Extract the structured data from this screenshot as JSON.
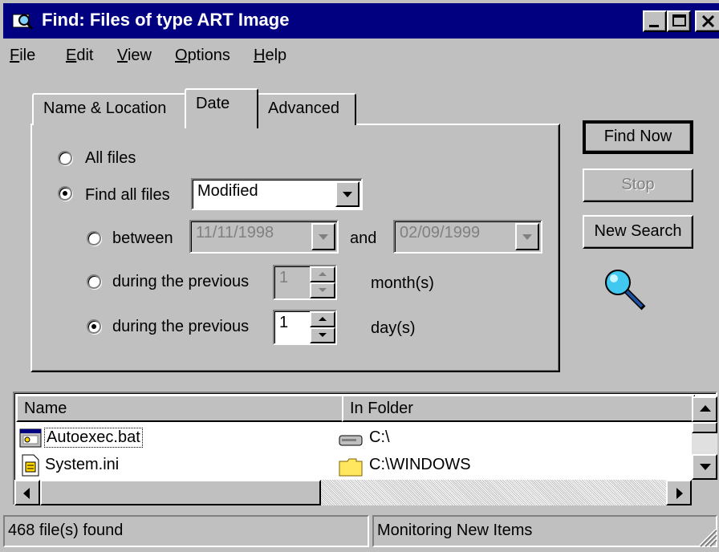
{
  "window": {
    "title": "Find: Files of type ART Image"
  },
  "menu": [
    "File",
    "Edit",
    "View",
    "Options",
    "Help"
  ],
  "tabs": [
    "Name & Location",
    "Date",
    "Advanced"
  ],
  "date_tab": {
    "all_files": "All files",
    "find_all_files": "Find all files",
    "find_type_value": "Modified",
    "between": "between",
    "from_date": "11/11/1998",
    "and": "and",
    "to_date": "02/09/1999",
    "previous_months_label": "during the previous",
    "previous_months_value": "1",
    "months_unit": "month(s)",
    "previous_days_label": "during the previous",
    "previous_days_value": "1",
    "days_unit": "day(s)",
    "selected_option": "during the previous day(s)"
  },
  "buttons": {
    "find_now": "Find Now",
    "stop": "Stop",
    "new_search": "New Search"
  },
  "results": {
    "columns": [
      "Name",
      "In Folder"
    ],
    "rows": [
      {
        "name": "Autoexec.bat",
        "folder": "C:\\"
      },
      {
        "name": "System.ini",
        "folder": "C:\\WINDOWS"
      }
    ]
  },
  "status": {
    "count": "468 file(s) found",
    "monitor": "Monitoring New Items"
  },
  "colors": {
    "titlebar": "#000080",
    "face": "#c0c0c0"
  }
}
